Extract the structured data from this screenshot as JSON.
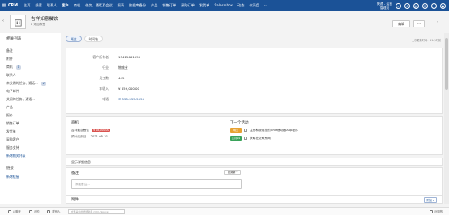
{
  "topnav": {
    "app_name": "CRM",
    "tabs": [
      "主页",
      "线索",
      "联系人",
      "客户",
      "商机",
      "任务、通话及会议",
      "报表",
      "数据库备份",
      "产品",
      "销售订单",
      "采购订单",
      "发货单",
      "Salesinbox",
      "动态",
      "仪表盘"
    ],
    "active_tab_index": 3,
    "user_line1": "快递 - 运营",
    "user_line2": "管理员"
  },
  "header": {
    "back_label": "‹",
    "title": "吉祥如意餐饮",
    "subtitle": "添加标签",
    "edit_label": "编辑",
    "more_label": "···",
    "forward_label": "›"
  },
  "leftnav": {
    "title": "相关列表",
    "items": [
      {
        "label": "备注",
        "badge": ""
      },
      {
        "label": "附件",
        "badge": ""
      },
      {
        "label": "商机",
        "badge": "1"
      },
      {
        "label": "联系人",
        "badge": ""
      },
      {
        "label": "未关闭的任务、通话...",
        "badge": "2"
      },
      {
        "label": "电子邮件",
        "badge": ""
      },
      {
        "label": "关闭的任务、通话...",
        "badge": ""
      },
      {
        "label": "产品",
        "badge": ""
      },
      {
        "label": "报价",
        "badge": ""
      },
      {
        "label": "销售订单",
        "badge": ""
      },
      {
        "label": "发货单",
        "badge": ""
      },
      {
        "label": "采购客户",
        "badge": ""
      },
      {
        "label": "服务支持",
        "badge": ""
      },
      {
        "label": "新增相关列表",
        "badge": "",
        "link": true
      }
    ],
    "section2_title": "链接",
    "section2_link": "新增链接"
  },
  "main": {
    "tabs": [
      "概览",
      "时间轴"
    ],
    "active_tab_index": 0,
    "last_updated": "上次更新时间：11小时前",
    "fields": [
      {
        "label": "客户所有者",
        "value": "15415661555"
      },
      {
        "label": "行业",
        "value": "物流业"
      },
      {
        "label": "员工数",
        "value": "445"
      },
      {
        "label": "年收入",
        "value": "¥ 659,000.00"
      },
      {
        "label": "电话",
        "value": "555-555-5555",
        "link": true
      }
    ],
    "opportunity": {
      "title": "商机",
      "name": "吉祥如意餐饮",
      "tag": "¥ 18,000.00",
      "date_label": "预计结束日",
      "date_value": "2021-05-31"
    },
    "next_activity": {
      "title": "下一个活动",
      "items": [
        {
          "tag": "明天",
          "color": "#e8a232",
          "text": "注册和使用您的CRM移动版App程序"
        },
        {
          "tag": "五月14",
          "color": "#3aa35a",
          "text": "获取社交联系网"
        }
      ]
    },
    "more_info": "显示详细信息",
    "notes": {
      "title": "备注",
      "sort_label": "旧到新 ▾",
      "placeholder": "添加备注..."
    },
    "attachments": {
      "title": "附件",
      "attach_label": "附加 ▾"
    }
  },
  "utility": {
    "items": [
      "以聊天",
      "近的",
      "联系人",
      "近期的"
    ],
    "input_placeholder": "这里是您的智能助手 (Ctrl+Space)"
  }
}
